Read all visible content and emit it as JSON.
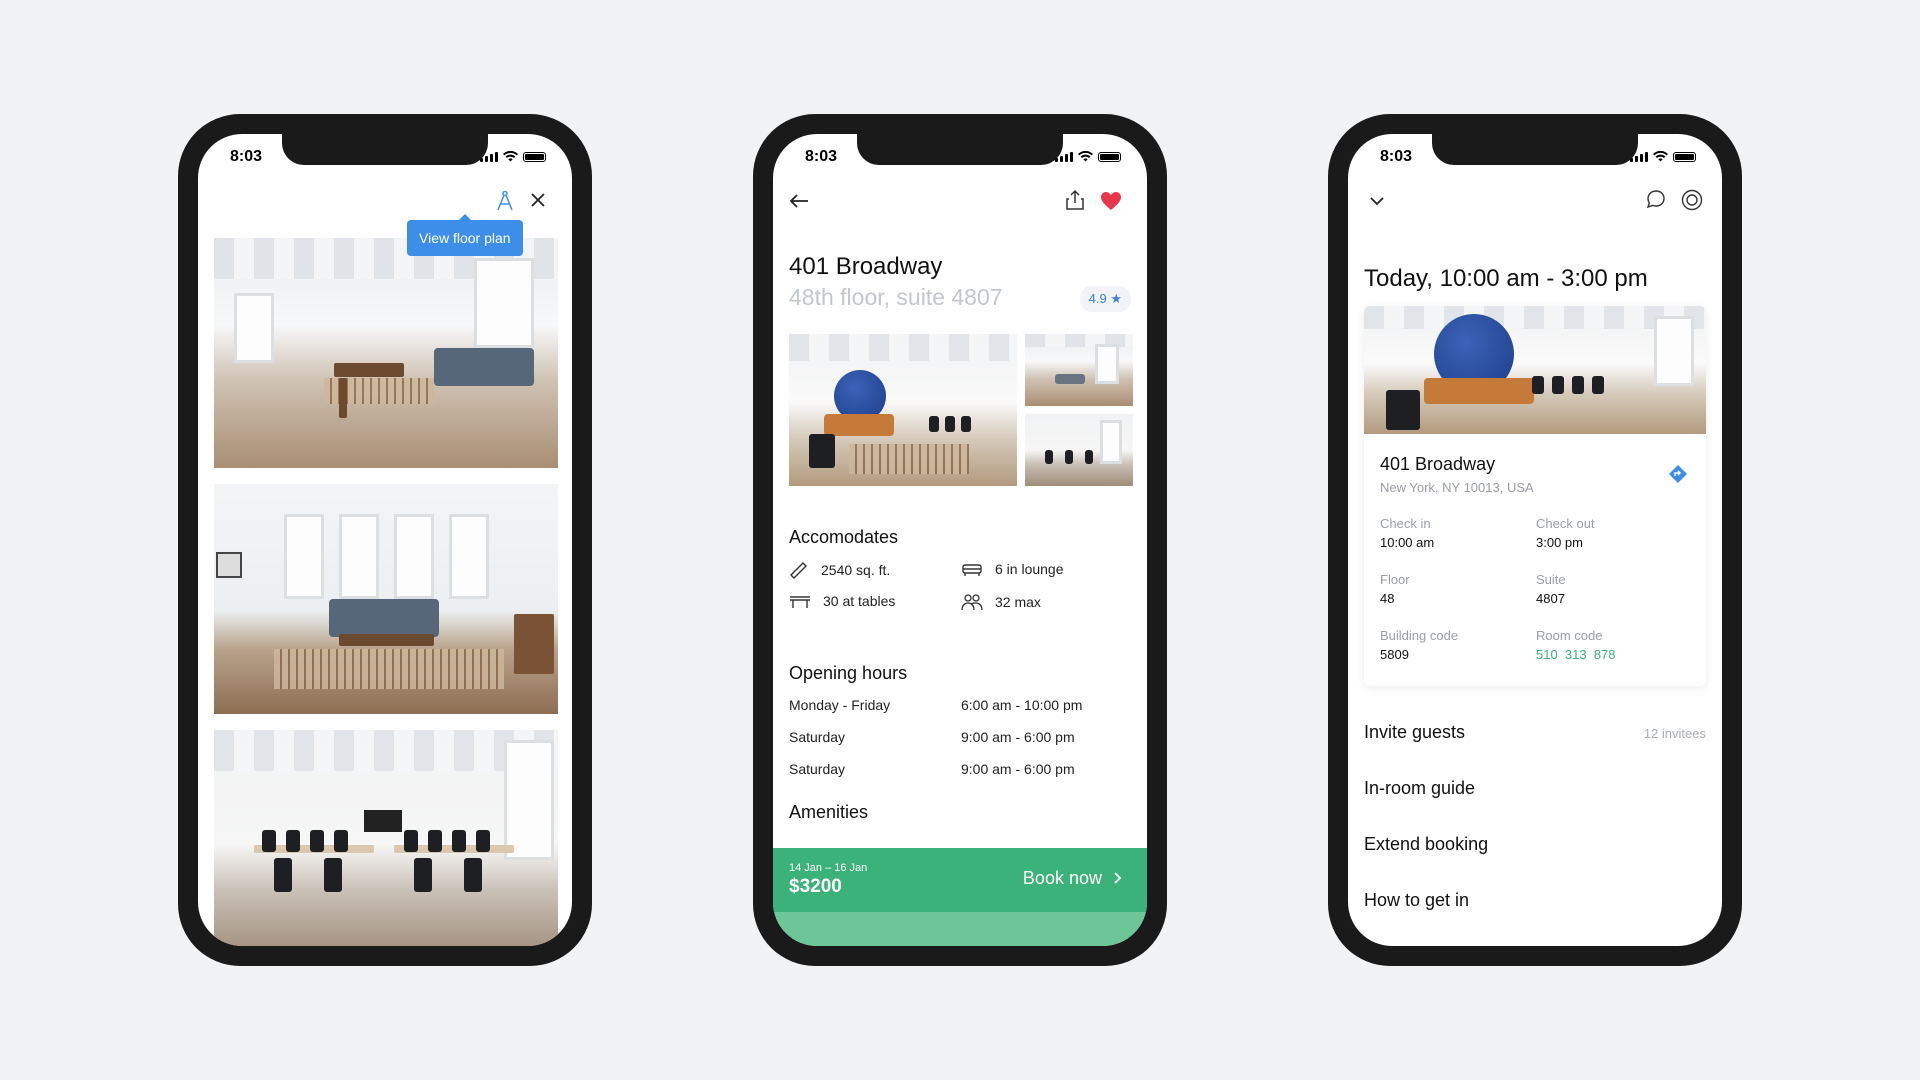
{
  "status": {
    "time": "8:03"
  },
  "phone1": {
    "tooltip": "View floor plan",
    "icons": [
      "floor-plan-icon",
      "close-icon"
    ]
  },
  "phone2": {
    "title": "401 Broadway",
    "subtitle": "48th floor, suite 4807",
    "rating": "4.9 ★",
    "accommodates": {
      "heading": "Accomodates",
      "items": [
        {
          "icon": "ruler-icon",
          "label": "2540 sq. ft."
        },
        {
          "icon": "sofa-icon",
          "label": "6 in lounge"
        },
        {
          "icon": "table-icon",
          "label": "30 at tables"
        },
        {
          "icon": "people-icon",
          "label": "32 max"
        }
      ]
    },
    "opening_hours": {
      "heading": "Opening hours",
      "rows": [
        {
          "day": "Monday - Friday",
          "time": "6:00 am - 10:00 pm"
        },
        {
          "day": "Saturday",
          "time": "9:00 am - 6:00 pm"
        },
        {
          "day": "Saturday",
          "time": "9:00 am - 6:00 pm"
        }
      ]
    },
    "amenities_heading": "Amenities",
    "booking": {
      "dates": "14 Jan – 16 Jan",
      "price": "$3200",
      "cta": "Book now"
    },
    "colors": {
      "accent": "#3bb27a",
      "favorite": "#e8374b"
    }
  },
  "phone3": {
    "heading": "Today, 10:00 am - 3:00 pm",
    "card": {
      "name": "401 Broadway",
      "address": "New York, NY 10013, USA",
      "details": [
        {
          "key": "Check in",
          "value": "10:00 am"
        },
        {
          "key": "Check out",
          "value": "3:00 pm"
        },
        {
          "key": "Floor",
          "value": "48"
        },
        {
          "key": "Suite",
          "value": "4807"
        },
        {
          "key": "Building code",
          "value": "5809"
        },
        {
          "key": "Room code",
          "value": "510  313  878"
        }
      ]
    },
    "menu": [
      {
        "label": "Invite guests",
        "aux": "12 invitees"
      },
      {
        "label": "In-room guide",
        "aux": ""
      },
      {
        "label": "Extend booking",
        "aux": ""
      },
      {
        "label": "How to get in",
        "aux": ""
      }
    ]
  }
}
